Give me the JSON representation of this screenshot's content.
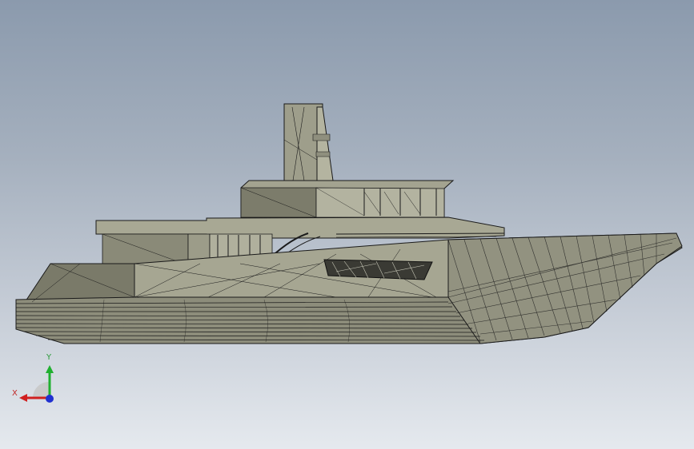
{
  "viewport": {
    "background_top": "#8b9aad",
    "background_bottom": "#e5e9ee",
    "model_color": "#a7a793",
    "model_shadow_color": "#6d6d5e",
    "edge_color": "#1a1a1a"
  },
  "triad": {
    "x_label": "X",
    "y_label": "Y",
    "x_color": "#d02020",
    "y_color": "#20b030",
    "z_color": "#2030d0"
  }
}
